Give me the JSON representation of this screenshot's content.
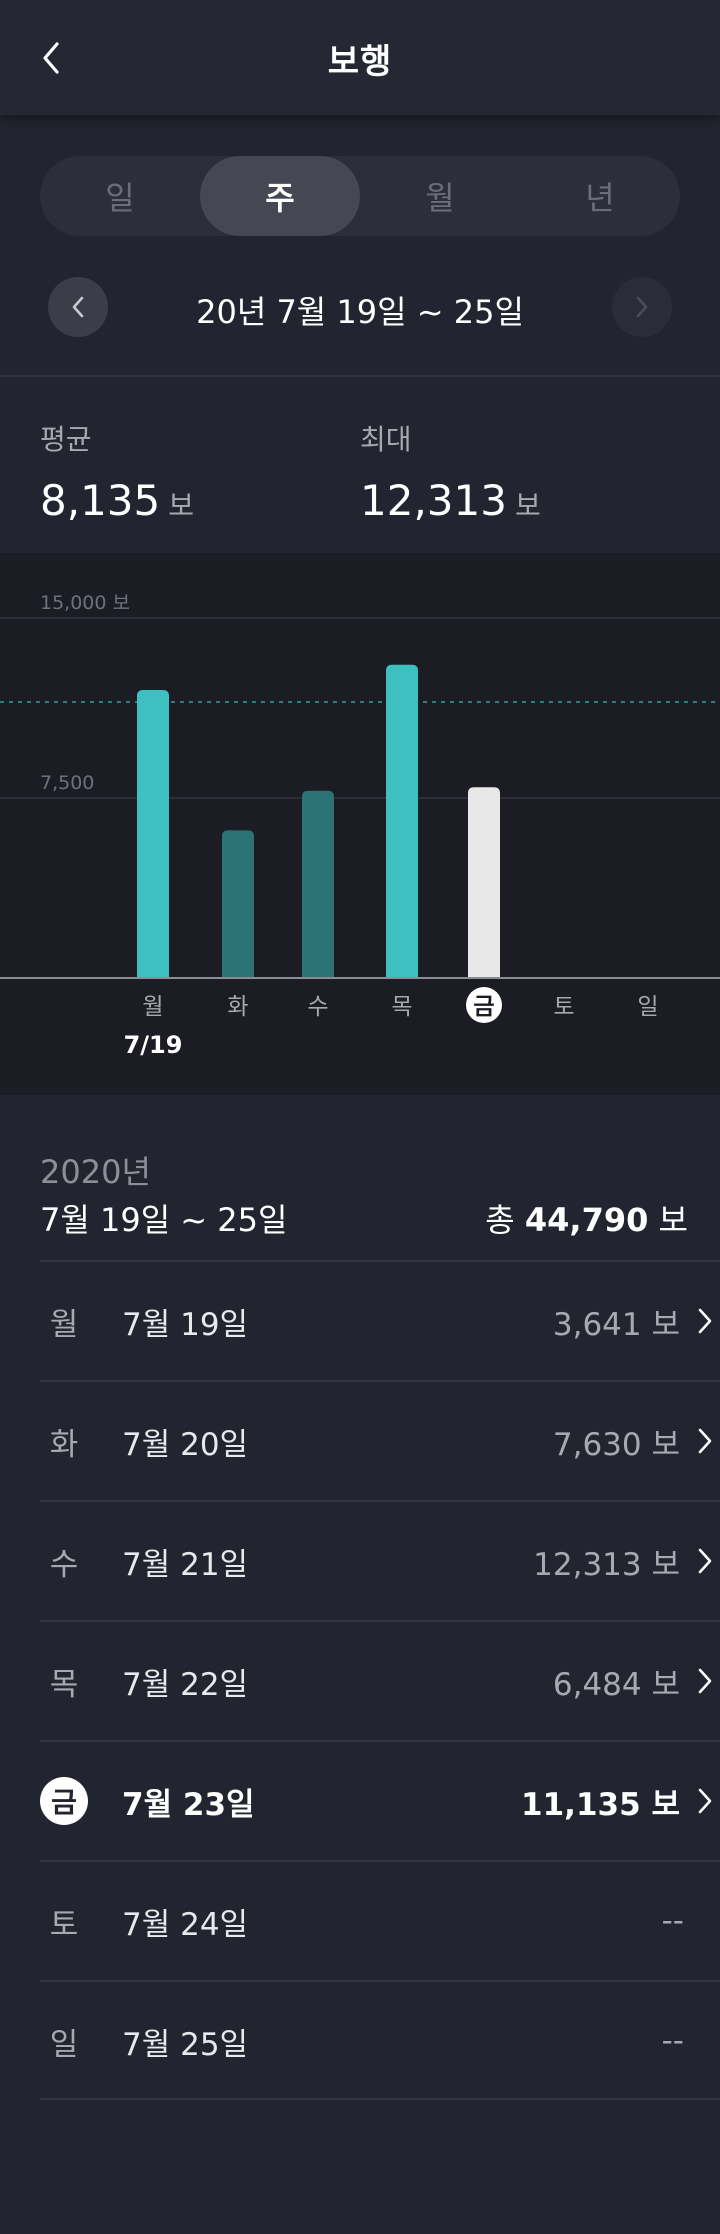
{
  "header": {
    "title": "보행",
    "back_icon": "chevron-left-icon"
  },
  "period_tabs": [
    {
      "label": "일",
      "active": false
    },
    {
      "label": "주",
      "active": true
    },
    {
      "label": "월",
      "active": false
    },
    {
      "label": "년",
      "active": false
    }
  ],
  "date_nav": {
    "range": "20년 7월 19일 ~ 25일",
    "prev_icon": "chevron-left-icon",
    "next_icon": "chevron-right-icon"
  },
  "stats": {
    "average": {
      "label": "평균",
      "value": "8,135",
      "unit": "보"
    },
    "max": {
      "label": "최대",
      "value": "12,313",
      "unit": "보"
    }
  },
  "chart_data": {
    "type": "bar",
    "categories": [
      "월",
      "화",
      "수",
      "목",
      "금",
      "토",
      "일"
    ],
    "values": [
      12000,
      6150,
      7800,
      13050,
      7950,
      null,
      null
    ],
    "ylim": [
      0,
      15000
    ],
    "y_ticks": [
      {
        "value": 15000,
        "label": "15,000 보"
      },
      {
        "value": 7500,
        "label": "7,500"
      }
    ],
    "goal_line": 11500,
    "selected_category": "금",
    "date_label": "7/19",
    "grid": true,
    "colors": {
      "high": "#3ebfc0",
      "low": "#2b7274",
      "selected": "#e8e8e8",
      "goal_line": "#3ebfc0",
      "axis": "#8a8c94"
    }
  },
  "summary": {
    "year": "2020년",
    "range": "7월 19일 ~ 25일",
    "total_prefix": "총",
    "total_value": "44,790",
    "total_unit": "보"
  },
  "days": [
    {
      "day": "월",
      "date": "7월 19일",
      "steps": "3,641 보",
      "has_detail": true,
      "today": false
    },
    {
      "day": "화",
      "date": "7월 20일",
      "steps": "7,630 보",
      "has_detail": true,
      "today": false
    },
    {
      "day": "수",
      "date": "7월 21일",
      "steps": "12,313 보",
      "has_detail": true,
      "today": false
    },
    {
      "day": "목",
      "date": "7월 22일",
      "steps": "6,484 보",
      "has_detail": true,
      "today": false
    },
    {
      "day": "금",
      "date": "7월 23일",
      "steps": "11,135 보",
      "has_detail": true,
      "today": true
    },
    {
      "day": "토",
      "date": "7월 24일",
      "steps": "--",
      "has_detail": false,
      "today": false
    },
    {
      "day": "일",
      "date": "7월 25일",
      "steps": "--",
      "has_detail": false,
      "today": false
    }
  ]
}
